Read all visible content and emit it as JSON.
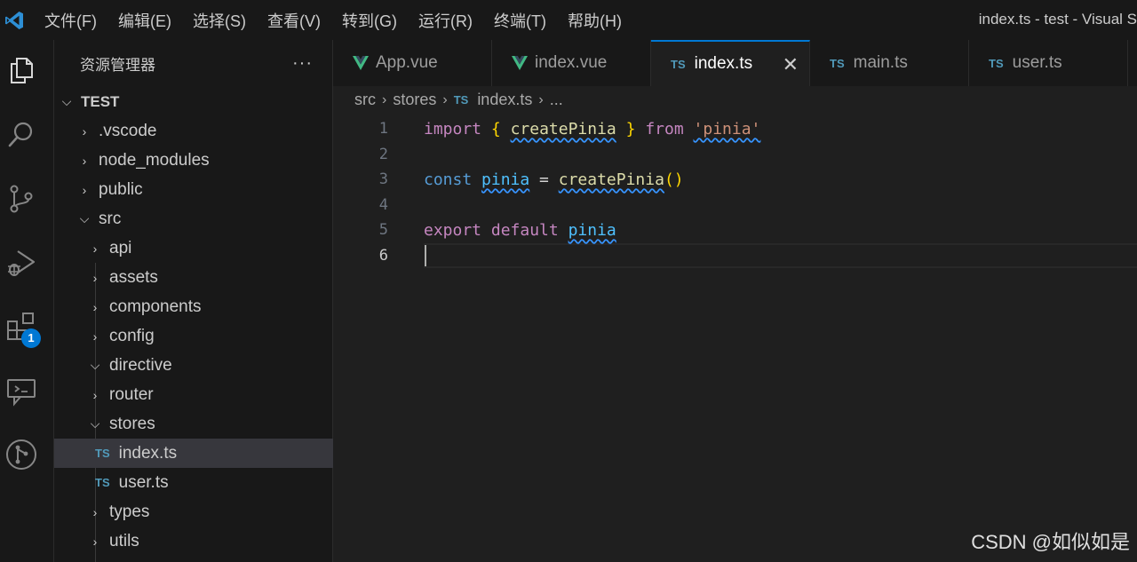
{
  "titlebar": {
    "menu": [
      "文件(F)",
      "编辑(E)",
      "选择(S)",
      "查看(V)",
      "转到(G)",
      "运行(R)",
      "终端(T)",
      "帮助(H)"
    ],
    "window_title": "index.ts - test - Visual S"
  },
  "activitybar": {
    "icons": [
      "explorer-icon",
      "search-icon",
      "source-control-icon",
      "run-debug-icon",
      "extensions-icon",
      "remote-explorer-icon",
      "git-graph-icon"
    ],
    "extensions_badge": "1",
    "accent_color": "#0078d4"
  },
  "sidebar": {
    "title": "资源管理器",
    "more_label": "···",
    "root": "TEST",
    "items": [
      {
        "label": ".vscode",
        "type": "folder",
        "expanded": false
      },
      {
        "label": "node_modules",
        "type": "folder",
        "expanded": false
      },
      {
        "label": "public",
        "type": "folder",
        "expanded": false
      },
      {
        "label": "src",
        "type": "folder",
        "expanded": true
      },
      {
        "label": "api",
        "type": "folder",
        "expanded": false
      },
      {
        "label": "assets",
        "type": "folder",
        "expanded": false
      },
      {
        "label": "components",
        "type": "folder",
        "expanded": false
      },
      {
        "label": "config",
        "type": "folder",
        "expanded": false
      },
      {
        "label": "directive",
        "type": "folder",
        "expanded": true
      },
      {
        "label": "router",
        "type": "folder",
        "expanded": false
      },
      {
        "label": "stores",
        "type": "folder",
        "expanded": true
      },
      {
        "label": "index.ts",
        "type": "ts-file",
        "selected": true
      },
      {
        "label": "user.ts",
        "type": "ts-file"
      },
      {
        "label": "types",
        "type": "folder",
        "expanded": false
      },
      {
        "label": "utils",
        "type": "folder",
        "expanded": false
      }
    ]
  },
  "tabs": [
    {
      "label": "App.vue",
      "icon": "vue-icon"
    },
    {
      "label": "index.vue",
      "icon": "vue-icon"
    },
    {
      "label": "index.ts",
      "icon": "TS",
      "active": true,
      "close": "✕"
    },
    {
      "label": "main.ts",
      "icon": "TS"
    },
    {
      "label": "user.ts",
      "icon": "TS"
    }
  ],
  "breadcrumb": {
    "parts": [
      "src",
      "stores",
      "index.ts",
      "..."
    ],
    "file_icon": "TS"
  },
  "editor": {
    "line_numbers": [
      "1",
      "2",
      "3",
      "4",
      "5",
      "6"
    ],
    "current_line": "6",
    "lines": [
      [
        {
          "t": "import",
          "c": "kw"
        },
        {
          "t": " ",
          "c": "op"
        },
        {
          "t": "{",
          "c": "br"
        },
        {
          "t": " ",
          "c": "op"
        },
        {
          "t": "createPinia",
          "c": "fn",
          "squig": true
        },
        {
          "t": " ",
          "c": "op"
        },
        {
          "t": "}",
          "c": "br"
        },
        {
          "t": " ",
          "c": "op"
        },
        {
          "t": "from",
          "c": "kw"
        },
        {
          "t": " ",
          "c": "op"
        },
        {
          "t": "'pinia'",
          "c": "str",
          "squig": true
        }
      ],
      [],
      [
        {
          "t": "const",
          "c": "kwb"
        },
        {
          "t": " ",
          "c": "op"
        },
        {
          "t": "pinia",
          "c": "var",
          "squig": true
        },
        {
          "t": " = ",
          "c": "op"
        },
        {
          "t": "createPinia",
          "c": "fn",
          "squig": true
        },
        {
          "t": "()",
          "c": "br"
        }
      ],
      [],
      [
        {
          "t": "export",
          "c": "kw"
        },
        {
          "t": " ",
          "c": "op"
        },
        {
          "t": "default",
          "c": "kw"
        },
        {
          "t": " ",
          "c": "op"
        },
        {
          "t": "pinia",
          "c": "var",
          "squig": true
        }
      ],
      []
    ]
  },
  "watermark": "CSDN @如似如是"
}
